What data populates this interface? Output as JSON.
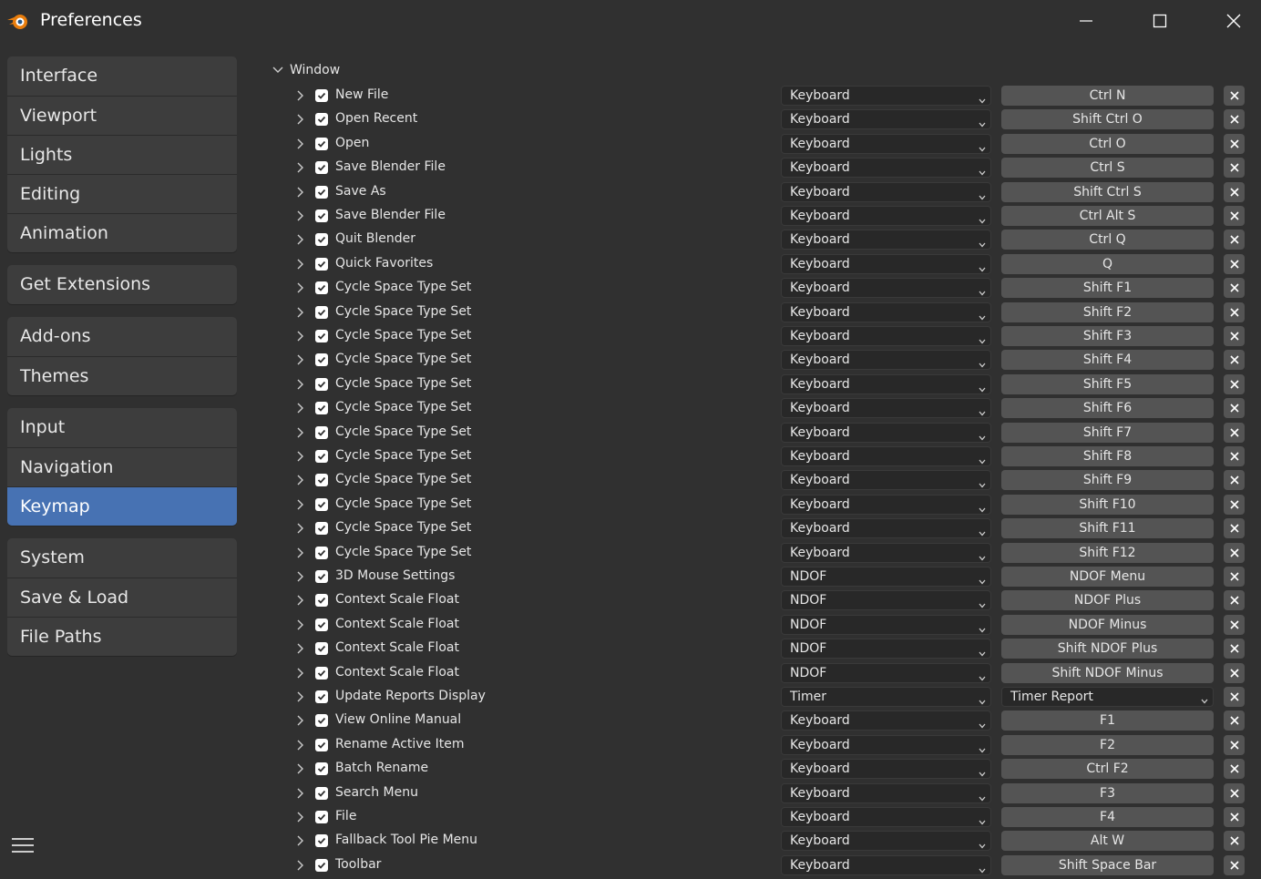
{
  "window": {
    "title": "Preferences",
    "icons": [
      "blender-logo-icon",
      "minimize-icon",
      "maximize-icon",
      "close-icon"
    ]
  },
  "sidebar": {
    "groups": [
      [
        "Interface",
        "Viewport",
        "Lights",
        "Editing",
        "Animation"
      ],
      [
        "Get Extensions"
      ],
      [
        "Add-ons",
        "Themes"
      ],
      [
        "Input",
        "Navigation",
        "Keymap"
      ],
      [
        "System",
        "Save & Load",
        "File Paths"
      ]
    ],
    "active": "Keymap"
  },
  "keymap": {
    "section_label": "Window",
    "rows": [
      {
        "name": "New File",
        "type": "Keyboard",
        "key": "Ctrl N"
      },
      {
        "name": "Open Recent",
        "type": "Keyboard",
        "key": "Shift Ctrl O"
      },
      {
        "name": "Open",
        "type": "Keyboard",
        "key": "Ctrl O"
      },
      {
        "name": "Save Blender File",
        "type": "Keyboard",
        "key": "Ctrl S"
      },
      {
        "name": "Save As",
        "type": "Keyboard",
        "key": "Shift Ctrl S"
      },
      {
        "name": "Save Blender File",
        "type": "Keyboard",
        "key": "Ctrl Alt S"
      },
      {
        "name": "Quit Blender",
        "type": "Keyboard",
        "key": "Ctrl Q"
      },
      {
        "name": "Quick Favorites",
        "type": "Keyboard",
        "key": "Q"
      },
      {
        "name": "Cycle Space Type Set",
        "type": "Keyboard",
        "key": "Shift F1"
      },
      {
        "name": "Cycle Space Type Set",
        "type": "Keyboard",
        "key": "Shift F2"
      },
      {
        "name": "Cycle Space Type Set",
        "type": "Keyboard",
        "key": "Shift F3"
      },
      {
        "name": "Cycle Space Type Set",
        "type": "Keyboard",
        "key": "Shift F4"
      },
      {
        "name": "Cycle Space Type Set",
        "type": "Keyboard",
        "key": "Shift F5"
      },
      {
        "name": "Cycle Space Type Set",
        "type": "Keyboard",
        "key": "Shift F6"
      },
      {
        "name": "Cycle Space Type Set",
        "type": "Keyboard",
        "key": "Shift F7"
      },
      {
        "name": "Cycle Space Type Set",
        "type": "Keyboard",
        "key": "Shift F8"
      },
      {
        "name": "Cycle Space Type Set",
        "type": "Keyboard",
        "key": "Shift F9"
      },
      {
        "name": "Cycle Space Type Set",
        "type": "Keyboard",
        "key": "Shift F10"
      },
      {
        "name": "Cycle Space Type Set",
        "type": "Keyboard",
        "key": "Shift F11"
      },
      {
        "name": "Cycle Space Type Set",
        "type": "Keyboard",
        "key": "Shift F12"
      },
      {
        "name": "3D Mouse Settings",
        "type": "NDOF",
        "key": "NDOF Menu"
      },
      {
        "name": "Context Scale Float",
        "type": "NDOF",
        "key": "NDOF Plus"
      },
      {
        "name": "Context Scale Float",
        "type": "NDOF",
        "key": "NDOF Minus"
      },
      {
        "name": "Context Scale Float",
        "type": "NDOF",
        "key": "Shift NDOF Plus"
      },
      {
        "name": "Context Scale Float",
        "type": "NDOF",
        "key": "Shift NDOF Minus"
      },
      {
        "name": "Update Reports Display",
        "type": "Timer",
        "key": "Timer Report",
        "key_is_dropdown": true
      },
      {
        "name": "View Online Manual",
        "type": "Keyboard",
        "key": "F1"
      },
      {
        "name": "Rename Active Item",
        "type": "Keyboard",
        "key": "F2"
      },
      {
        "name": "Batch Rename",
        "type": "Keyboard",
        "key": "Ctrl F2"
      },
      {
        "name": "Search Menu",
        "type": "Keyboard",
        "key": "F3"
      },
      {
        "name": "File",
        "type": "Keyboard",
        "key": "F4"
      },
      {
        "name": "Fallback Tool Pie Menu",
        "type": "Keyboard",
        "key": "Alt W"
      },
      {
        "name": "Toolbar",
        "type": "Keyboard",
        "key": "Shift Space Bar"
      }
    ]
  },
  "colors": {
    "background": "#303030",
    "panel": "#3d3d3d",
    "accent": "#4772b3",
    "field": "#282828",
    "key_button": "#545454"
  }
}
